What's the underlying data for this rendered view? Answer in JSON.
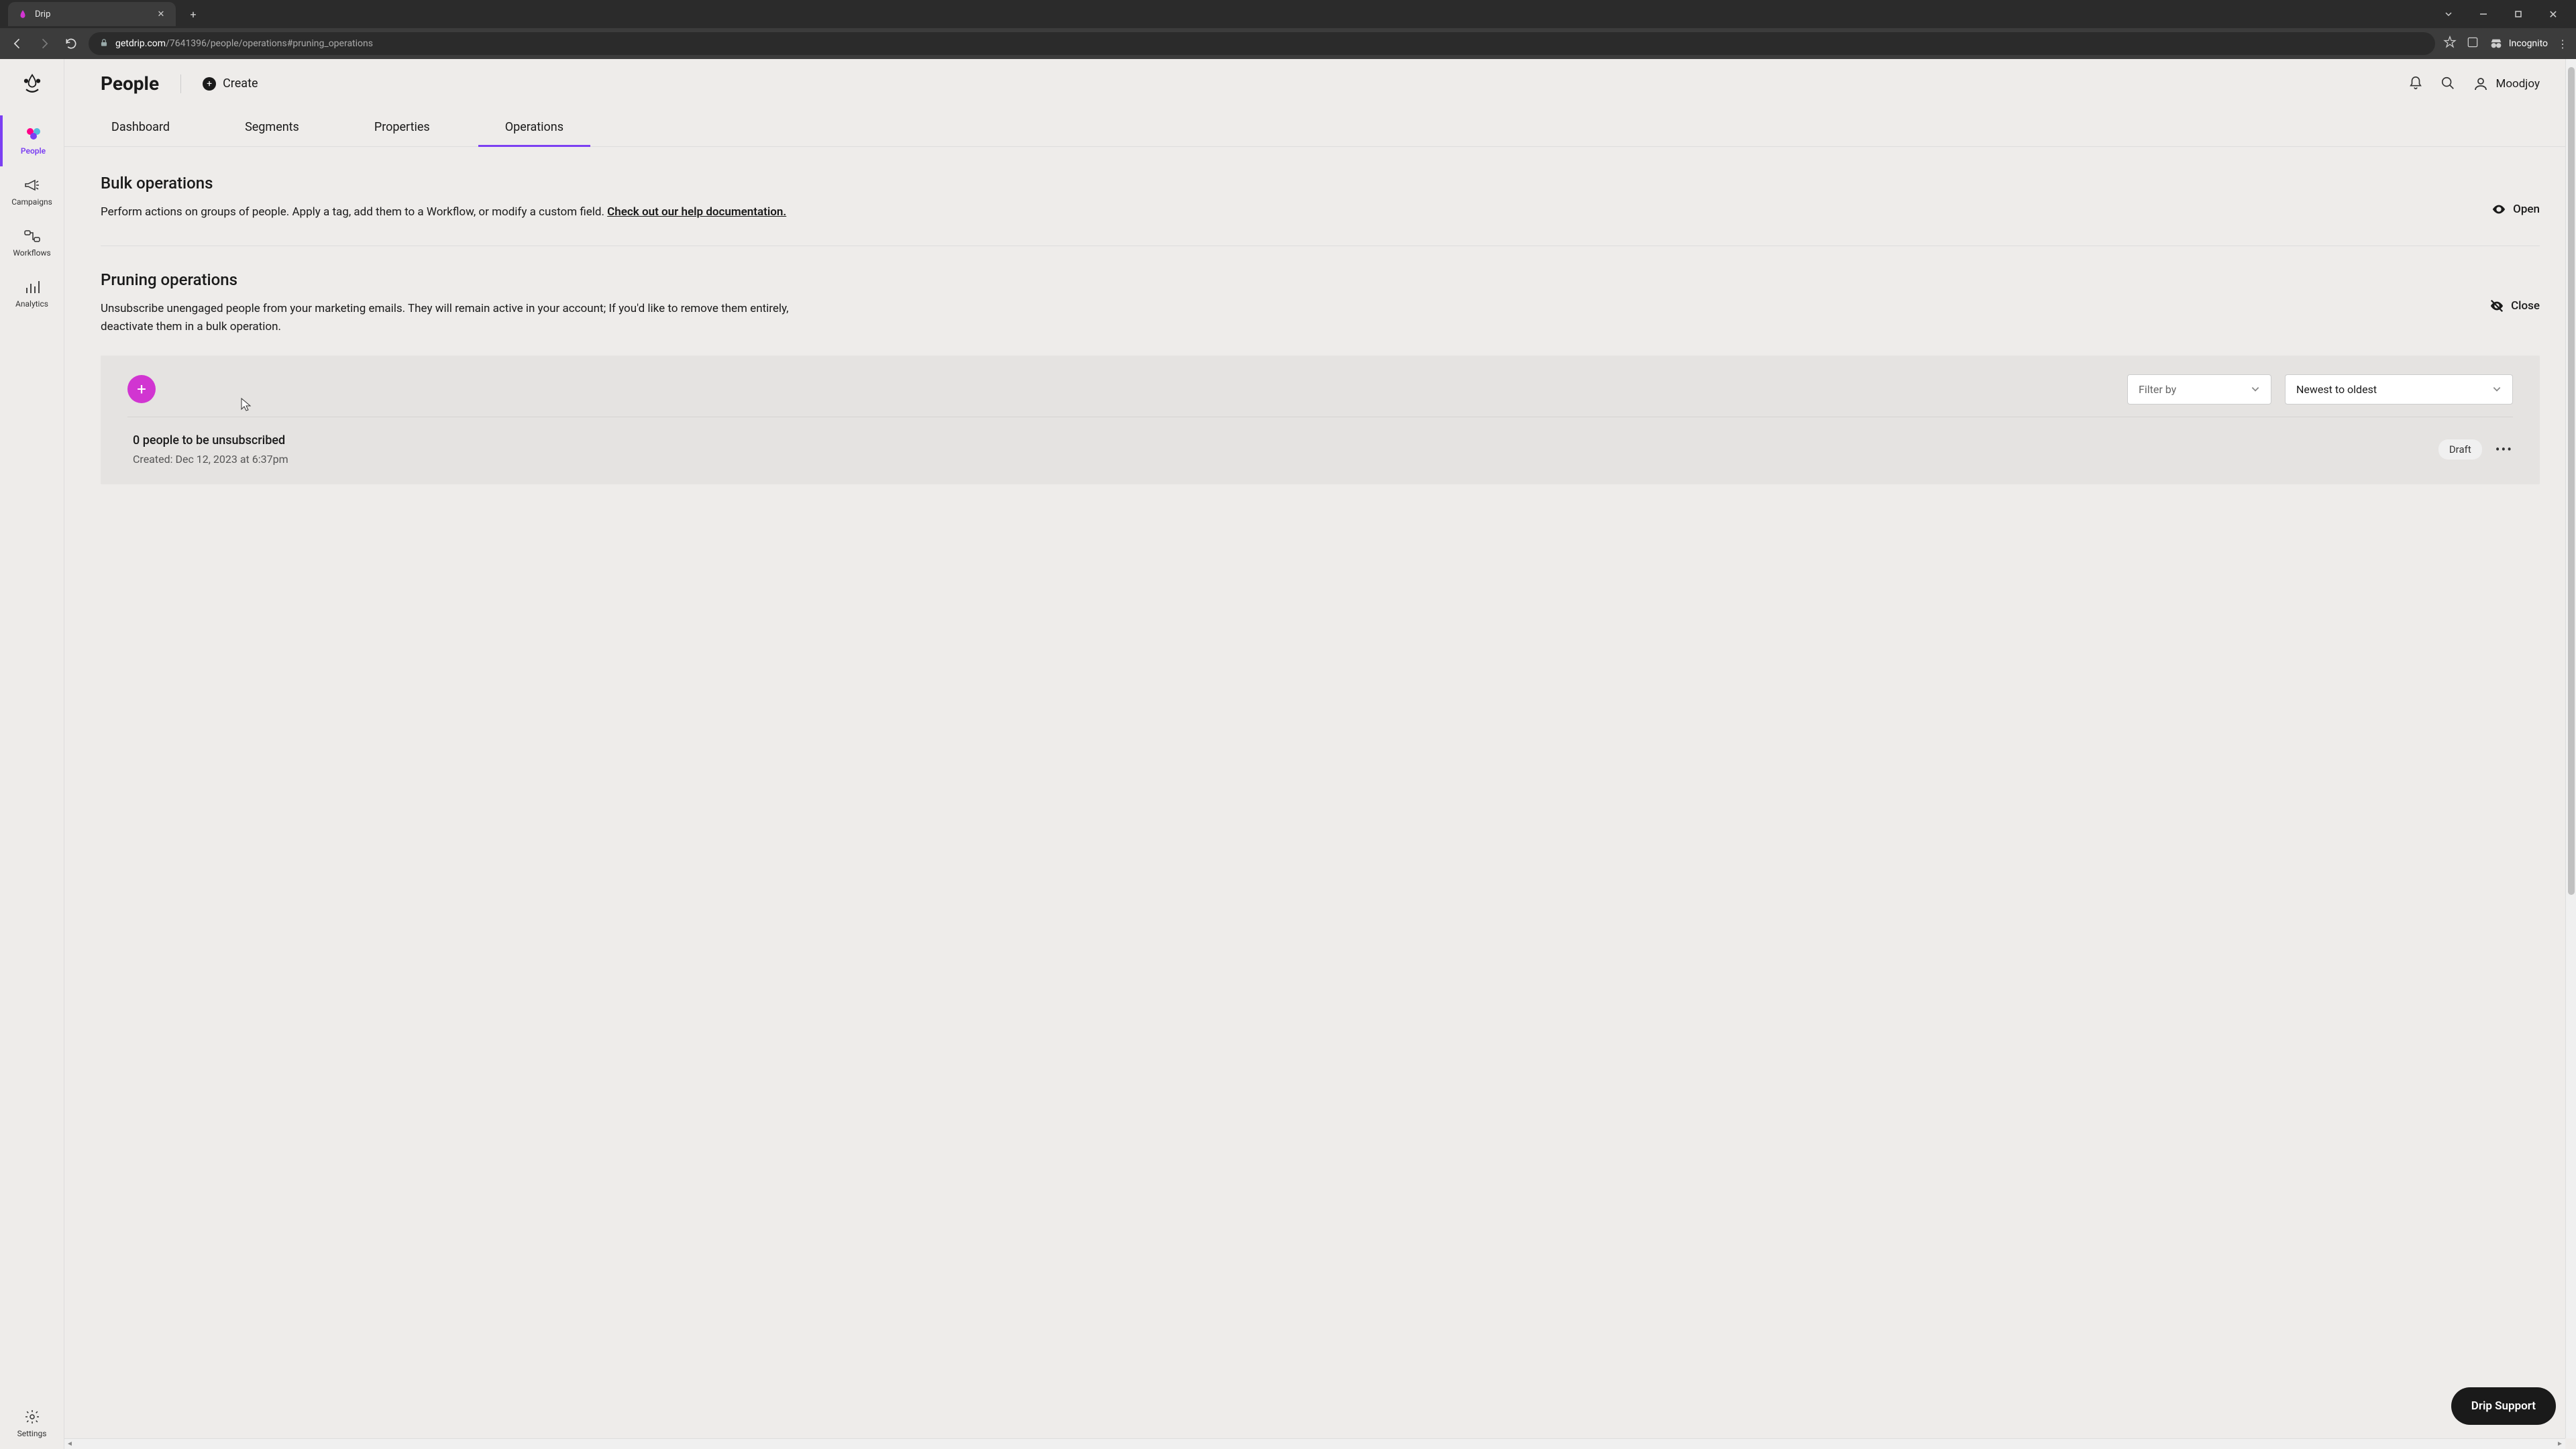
{
  "browser": {
    "tab_title": "Drip",
    "url_domain": "getdrip.com",
    "url_path": "/7641396/people/operations#pruning_operations",
    "incognito_label": "Incognito"
  },
  "sidebar": {
    "items": [
      {
        "label": "People",
        "name": "sidebar-item-people"
      },
      {
        "label": "Campaigns",
        "name": "sidebar-item-campaigns"
      },
      {
        "label": "Workflows",
        "name": "sidebar-item-workflows"
      },
      {
        "label": "Analytics",
        "name": "sidebar-item-analytics"
      }
    ],
    "settings_label": "Settings"
  },
  "header": {
    "page_title": "People",
    "create_label": "Create",
    "user_name": "Moodjoy"
  },
  "tabs": [
    {
      "label": "Dashboard",
      "name": "tab-dashboard"
    },
    {
      "label": "Segments",
      "name": "tab-segments"
    },
    {
      "label": "Properties",
      "name": "tab-properties"
    },
    {
      "label": "Operations",
      "name": "tab-operations"
    }
  ],
  "sections": {
    "bulk": {
      "title": "Bulk operations",
      "desc_text": "Perform actions on groups of people. Apply a tag, add them to a Workflow, or modify a custom field. ",
      "desc_link": "Check out our help documentation.",
      "toggle_label": "Open"
    },
    "pruning": {
      "title": "Pruning operations",
      "desc": "Unsubscribe unengaged people from your marketing emails. They will remain active in your account; If you'd like to remove them entirely, deactivate them in a bulk operation.",
      "toggle_label": "Close"
    }
  },
  "panel": {
    "filter_placeholder": "Filter by",
    "sort_value": "Newest to oldest",
    "operation": {
      "title": "0 people to be unsubscribed",
      "meta": "Created: Dec 12, 2023 at 6:37pm",
      "badge": "Draft"
    }
  },
  "support_label": "Drip Support"
}
